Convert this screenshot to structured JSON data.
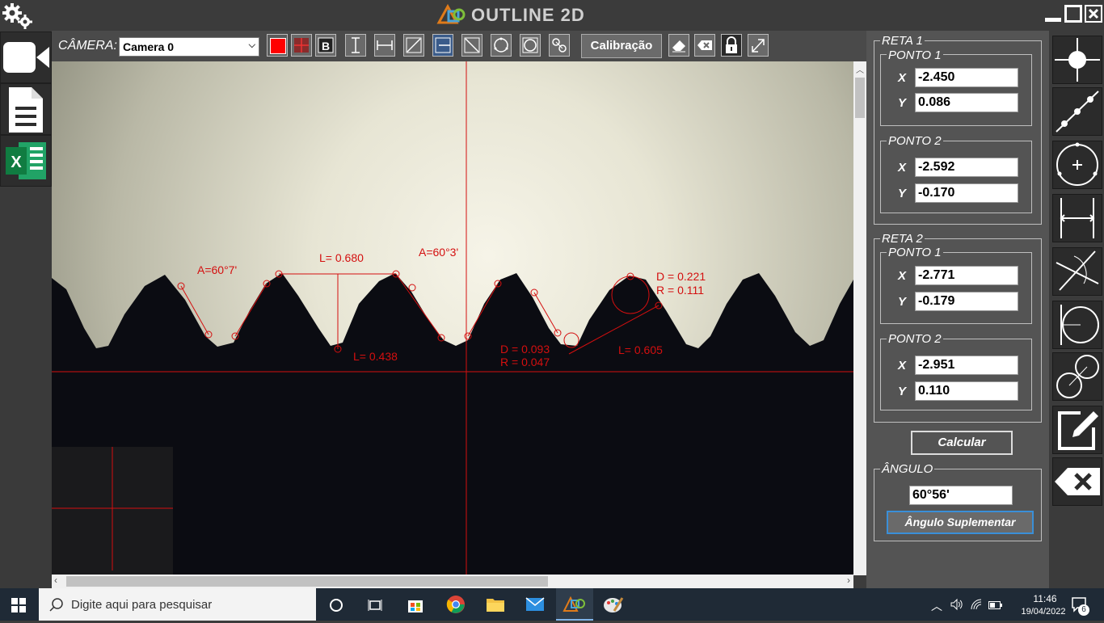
{
  "app": {
    "title": "OUTLINE 2D"
  },
  "toolbar": {
    "camera_label": "CÂMERA:",
    "camera_value": "Camera 0",
    "calibration_label": "Calibração",
    "color_red": "#ff0000"
  },
  "measurements": {
    "angle1": "A=60°7'",
    "length1": "L= 0.680",
    "angle2": "A=60°3'",
    "length2": "L= 0.438",
    "diameter1": "D = 0.093",
    "radius1": "R = 0.047",
    "diameter2": "D = 0.221",
    "radius2": "R = 0.111",
    "length3": "L= 0.605"
  },
  "panel": {
    "line1": {
      "title": "RETA 1",
      "p1": {
        "title": "PONTO 1",
        "x_label": "X",
        "y_label": "Y",
        "x": "-2.450",
        "y": "0.086"
      },
      "p2": {
        "title": "PONTO 2",
        "x_label": "X",
        "y_label": "Y",
        "x": "-2.592",
        "y": "-0.170"
      }
    },
    "line2": {
      "title": "RETA 2",
      "p1": {
        "title": "PONTO 1",
        "x_label": "X",
        "y_label": "Y",
        "x": "-2.771",
        "y": "-0.179"
      },
      "p2": {
        "title": "PONTO 2",
        "x_label": "X",
        "y_label": "Y",
        "x": "-2.951",
        "y": "0.110"
      }
    },
    "calculate_label": "Calcular",
    "angle_title": "ÂNGULO",
    "angle_value": "60°56'",
    "supplementary_label": "Ângulo Suplementar"
  },
  "taskbar": {
    "search_placeholder": "Digite aqui para pesquisar",
    "time": "11:46",
    "date": "19/04/2022",
    "notif_count": "6"
  }
}
